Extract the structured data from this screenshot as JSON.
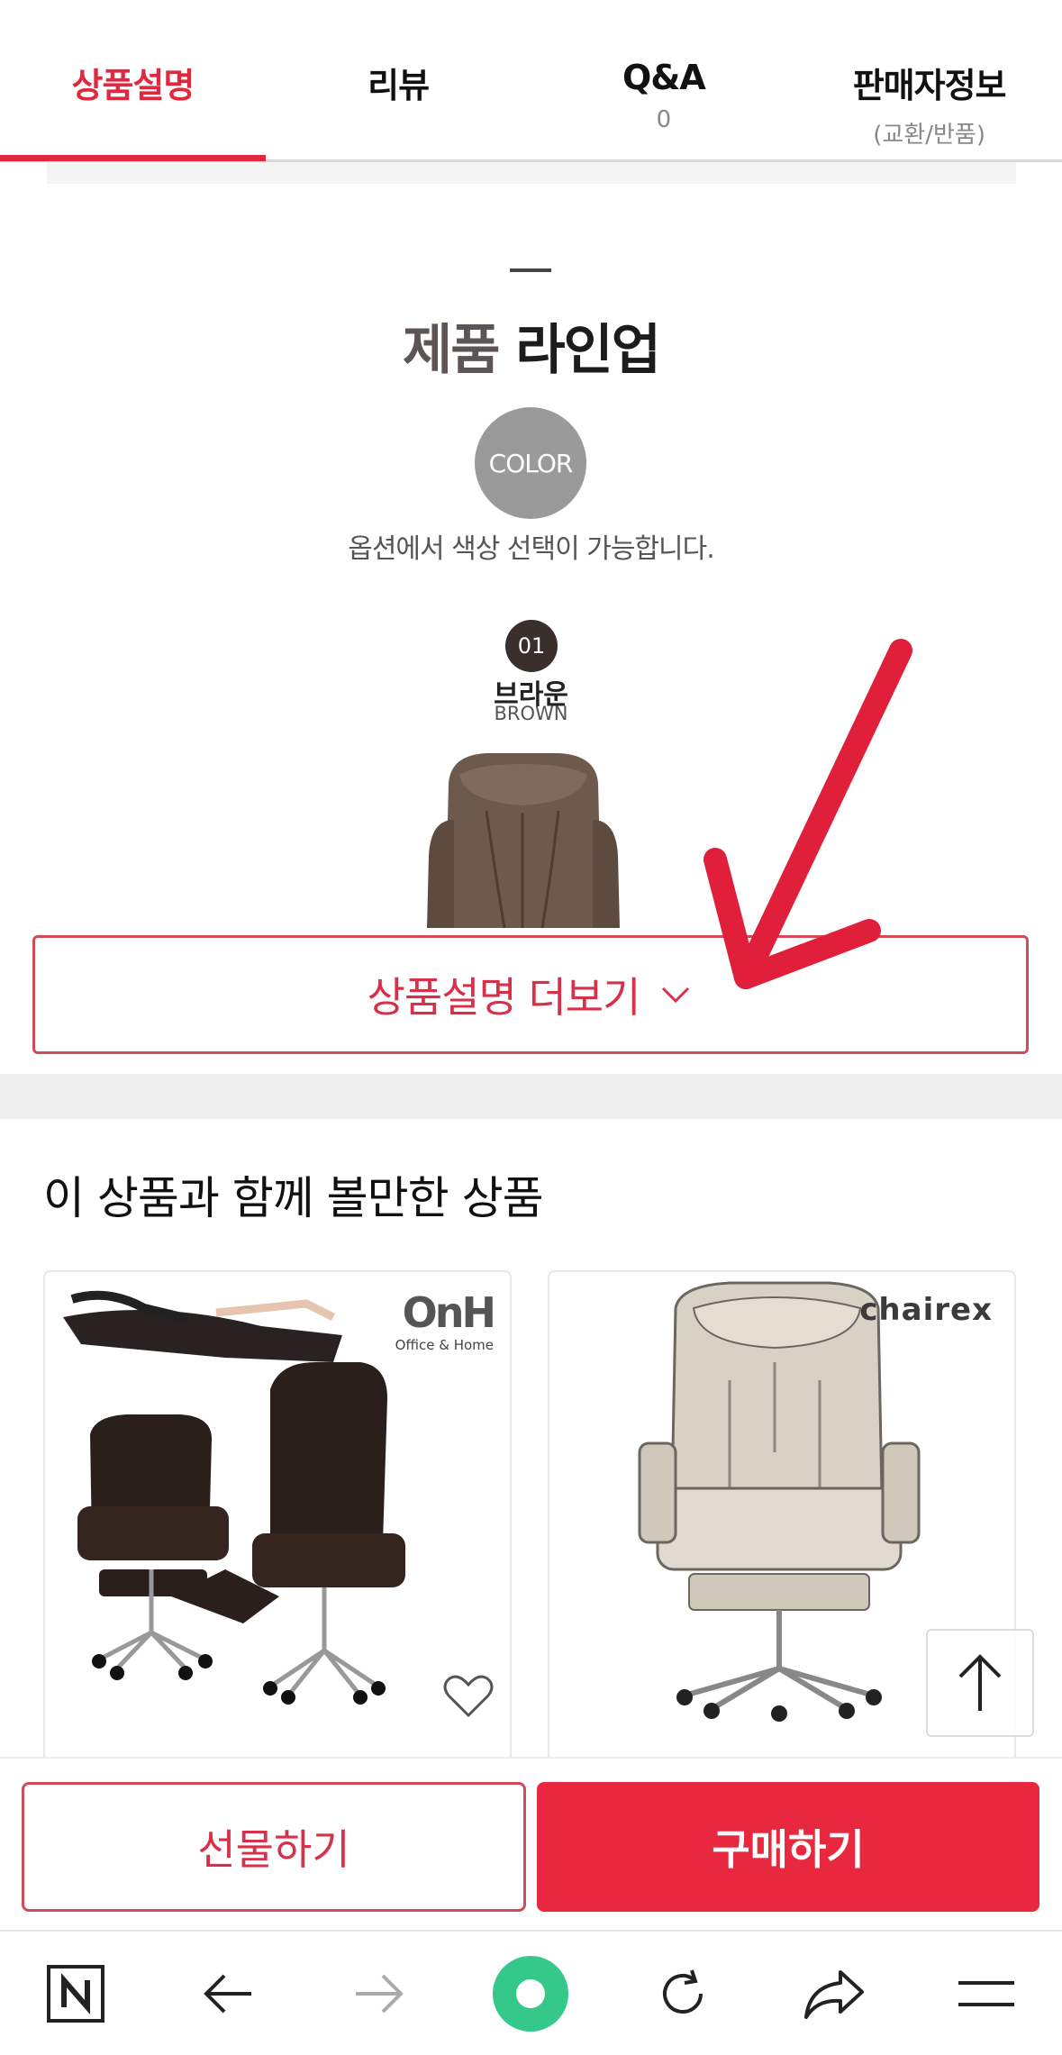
{
  "tabs": [
    {
      "label": "상품설명",
      "sub": ""
    },
    {
      "label": "리뷰",
      "sub": ""
    },
    {
      "label": "Q&A",
      "sub": "0"
    },
    {
      "label": "판매자정보",
      "sub": "(교환/반품)"
    }
  ],
  "description": {
    "lineup_title_a": "제품",
    "lineup_title_b": "라인업",
    "color_badge": "COLOR",
    "color_note": "옵션에서 색상 선택이 가능합니다.",
    "option_number": "01",
    "option_name_kr": "브라운",
    "option_name_en": "BROWN"
  },
  "more_button": {
    "label": "상품설명 더보기"
  },
  "related": {
    "title": "이 상품과 함께 볼만한 상품",
    "cards": [
      {
        "brand_logo": "OnH",
        "brand_sub": "Office & Home"
      },
      {
        "brand_logo": "chairex"
      }
    ]
  },
  "buybar": {
    "gift_label": "선물하기",
    "buy_label": "구매하기"
  },
  "icons": {
    "nav": [
      "naver-home-icon",
      "back-arrow-icon",
      "forward-arrow-icon",
      "green-dot-icon",
      "refresh-icon",
      "share-icon",
      "menu-icon"
    ],
    "up": "scroll-top-icon",
    "heart": "heart-icon"
  },
  "colors": {
    "accent": "#e0283f",
    "green": "#34c98a"
  }
}
